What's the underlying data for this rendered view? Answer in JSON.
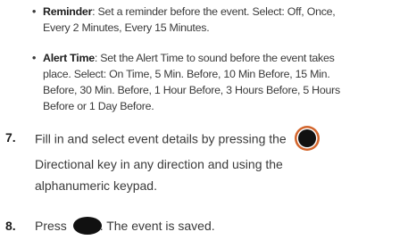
{
  "bullets": [
    {
      "marker": "•",
      "term": "Reminder",
      "line1": ": Set a reminder before the event. Select: Off, Once,",
      "line2": "Every 2 Minutes, Every 15 Minutes."
    },
    {
      "marker": "•",
      "term": "Alert Time",
      "line1": ": Set the Alert Time to sound before the event takes",
      "line2": "place. Select: On Time, 5 Min. Before, 10 Min Before, 15 Min.",
      "line3": "Before, 30 Min. Before, 1 Hour Before, 3 Hours Before, 5 Hours",
      "line4": "Before or 1 Day Before."
    }
  ],
  "steps": [
    {
      "number": "7.",
      "line1": "Fill in and select event details by pressing the",
      "line2": "Directional key in any direction and using the",
      "line3": "alphanumeric keypad.",
      "icon": "directional-key-icon"
    },
    {
      "number": "8.",
      "before_icon": "Press",
      "after_icon": ". The event is saved.",
      "icon": "ok-key-icon"
    }
  ],
  "colors": {
    "text": "#3a3a3a",
    "ring_orange": "#d2652c",
    "key_black": "#111111"
  }
}
